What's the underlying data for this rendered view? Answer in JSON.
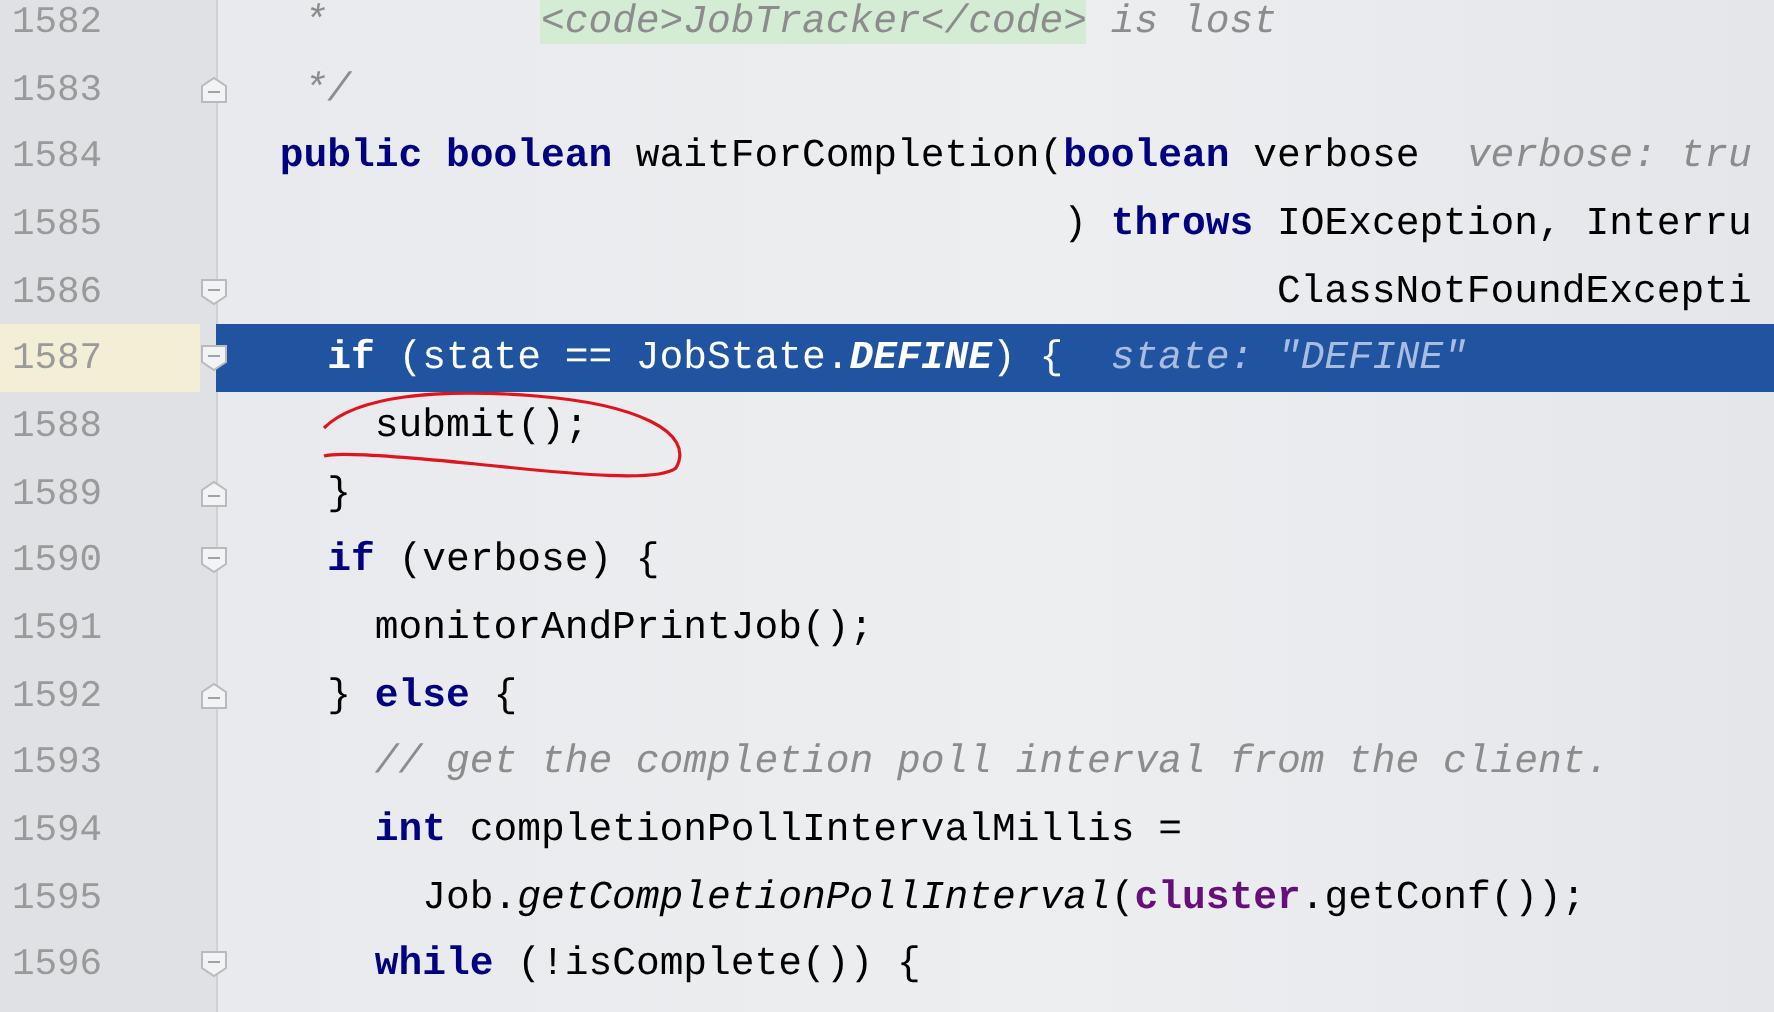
{
  "editor": {
    "lines": [
      {
        "number": "1582",
        "selected": false,
        "tokens": [
          {
            "kind": "comment",
            "text": "  *         "
          },
          {
            "kind": "doctag",
            "text": "<code>JobTracker</code>"
          },
          {
            "kind": "comment",
            "text": " is lost"
          }
        ]
      },
      {
        "number": "1583",
        "fold": {
          "kind": "close"
        },
        "selected": false,
        "tokens": [
          {
            "kind": "comment",
            "text": "  */"
          }
        ]
      },
      {
        "number": "1584",
        "selected": false,
        "tokens": [
          {
            "kind": "keyword",
            "text": " public boolean"
          },
          {
            "kind": "plain",
            "text": " waitForCompletion("
          },
          {
            "kind": "keyword",
            "text": "boolean"
          },
          {
            "kind": "plain",
            "text": " verbose  "
          },
          {
            "kind": "hint",
            "text": "verbose: tru"
          }
        ]
      },
      {
        "number": "1585",
        "selected": false,
        "tokens": [
          {
            "kind": "plain",
            "text": "                                  ) "
          },
          {
            "kind": "keyword",
            "text": "throws"
          },
          {
            "kind": "plain",
            "text": " IOException, Interru"
          }
        ]
      },
      {
        "number": "1586",
        "fold": {
          "kind": "open"
        },
        "selected": false,
        "tokens": [
          {
            "kind": "plain",
            "text": "                                           ClassNotFoundExcepti"
          }
        ]
      },
      {
        "number": "1587",
        "fold": {
          "kind": "open"
        },
        "selected": true,
        "tokens": [
          {
            "kind": "keyword",
            "text": "   if"
          },
          {
            "kind": "plain",
            "text": " (state == JobState."
          },
          {
            "kind": "constant",
            "text": "DEFINE"
          },
          {
            "kind": "plain",
            "text": ") {  "
          },
          {
            "kind": "hint",
            "text": "state: \"DEFINE\""
          }
        ]
      },
      {
        "number": "1588",
        "selected": false,
        "tokens": [
          {
            "kind": "plain",
            "text": "     submit();"
          }
        ]
      },
      {
        "number": "1589",
        "fold": {
          "kind": "close"
        },
        "selected": false,
        "tokens": [
          {
            "kind": "plain",
            "text": "   }"
          }
        ]
      },
      {
        "number": "1590",
        "fold": {
          "kind": "open"
        },
        "selected": false,
        "tokens": [
          {
            "kind": "keyword",
            "text": "   if"
          },
          {
            "kind": "plain",
            "text": " (verbose) {"
          }
        ]
      },
      {
        "number": "1591",
        "selected": false,
        "tokens": [
          {
            "kind": "plain",
            "text": "     monitorAndPrintJob();"
          }
        ]
      },
      {
        "number": "1592",
        "fold": {
          "kind": "close"
        },
        "selected": false,
        "tokens": [
          {
            "kind": "plain",
            "text": "   } "
          },
          {
            "kind": "keyword",
            "text": "else"
          },
          {
            "kind": "plain",
            "text": " {"
          }
        ]
      },
      {
        "number": "1593",
        "selected": false,
        "tokens": [
          {
            "kind": "comment",
            "text": "     // get the completion poll interval from the client."
          }
        ]
      },
      {
        "number": "1594",
        "selected": false,
        "tokens": [
          {
            "kind": "keyword",
            "text": "     int"
          },
          {
            "kind": "plain",
            "text": " completionPollIntervalMillis ="
          }
        ]
      },
      {
        "number": "1595",
        "selected": false,
        "tokens": [
          {
            "kind": "plain",
            "text": "       Job."
          },
          {
            "kind": "static",
            "text": "getCompletionPollInterval"
          },
          {
            "kind": "plain",
            "text": "("
          },
          {
            "kind": "field",
            "text": "cluster"
          },
          {
            "kind": "plain",
            "text": ".getConf());"
          }
        ]
      },
      {
        "number": "1596",
        "fold": {
          "kind": "open"
        },
        "selected": false,
        "tokens": [
          {
            "kind": "keyword",
            "text": "     while"
          },
          {
            "kind": "plain",
            "text": " (!isComplete()) {"
          }
        ]
      }
    ]
  }
}
